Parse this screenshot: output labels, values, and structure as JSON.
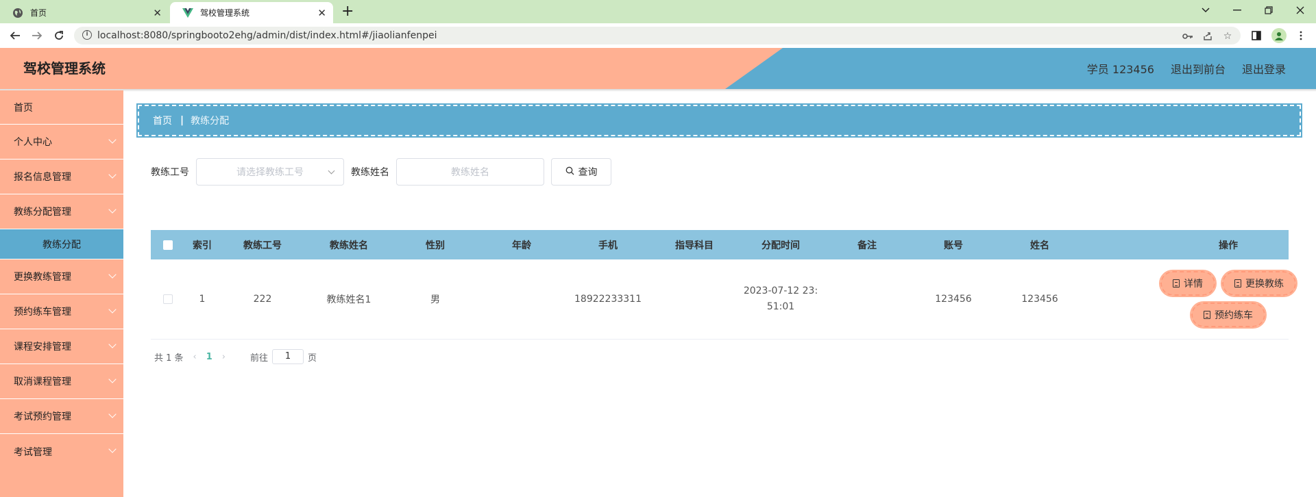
{
  "browser": {
    "tabs": [
      {
        "label": "首页"
      },
      {
        "label": "驾校管理系统"
      }
    ],
    "url": "localhost:8080/springbooto2ehg/admin/dist/index.html#/jiaolianfenpei"
  },
  "header": {
    "title": "驾校管理系统",
    "user": "学员 123456",
    "to_front": "退出到前台",
    "logout": "退出登录"
  },
  "sidebar": {
    "items": [
      {
        "label": "首页"
      },
      {
        "label": "个人中心"
      },
      {
        "label": "报名信息管理"
      },
      {
        "label": "教练分配管理"
      },
      {
        "label": "更换教练管理"
      },
      {
        "label": "预约练车管理"
      },
      {
        "label": "课程安排管理"
      },
      {
        "label": "取消课程管理"
      },
      {
        "label": "考试预约管理"
      },
      {
        "label": "考试管理"
      }
    ],
    "submenu": {
      "label": "教练分配"
    }
  },
  "breadcrumb": {
    "home": "首页",
    "sep": "|",
    "current": "教练分配"
  },
  "search": {
    "coach_no_label": "教练工号",
    "coach_no_placeholder": "请选择教练工号",
    "coach_name_label": "教练姓名",
    "coach_name_placeholder": "教练姓名",
    "query_label": "查询"
  },
  "table": {
    "headers": [
      "索引",
      "教练工号",
      "教练姓名",
      "性别",
      "年龄",
      "手机",
      "指导科目",
      "分配时间",
      "备注",
      "账号",
      "姓名",
      "操作"
    ],
    "rows": [
      {
        "index": "1",
        "coach_no": "222",
        "coach_name": "教练姓名1",
        "gender": "男",
        "age": "",
        "phone": "18922233311",
        "subject": "",
        "assign_time_1": "2023-07-12 23:",
        "assign_time_2": "51:01",
        "remark": "",
        "account": "123456",
        "name": "123456"
      }
    ],
    "ops": {
      "detail": "详情",
      "change": "更换教练",
      "book": "预约练车"
    }
  },
  "pager": {
    "total": "共 1 条",
    "page": "1",
    "goto": "前往",
    "goto_value": "1",
    "page_unit": "页"
  },
  "colors": {
    "salmon": "#ffb092",
    "blue": "#5dabcf",
    "table_head": "#8cc4df"
  }
}
